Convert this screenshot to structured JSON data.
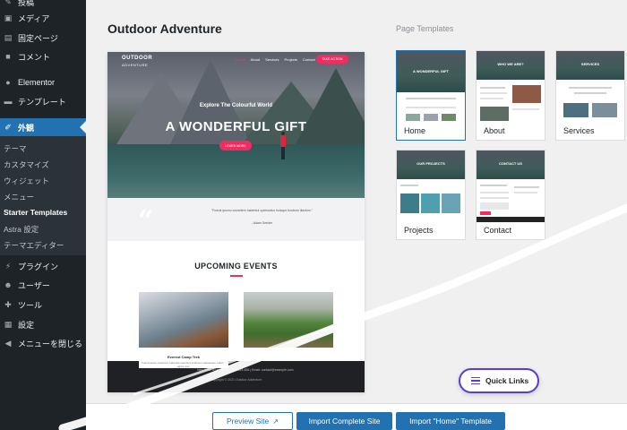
{
  "sidebar": {
    "items": [
      {
        "label": "投稿",
        "icon": "pushpin-icon"
      },
      {
        "label": "メディア",
        "icon": "media-icon"
      },
      {
        "label": "固定ページ",
        "icon": "page-icon"
      },
      {
        "label": "コメント",
        "icon": "comment-icon"
      },
      {
        "label": "Elementor",
        "icon": "elementor-icon"
      },
      {
        "label": "テンプレート",
        "icon": "folder-icon"
      },
      {
        "label": "外観",
        "icon": "brush-icon"
      }
    ],
    "submenu": [
      "テーマ",
      "カスタマイズ",
      "ウィジェット",
      "メニュー",
      "Starter Templates",
      "Astra 設定",
      "テーマエディター"
    ],
    "bottom_items": [
      {
        "label": "プラグイン",
        "icon": "plugin-icon"
      },
      {
        "label": "ユーザー",
        "icon": "user-icon"
      },
      {
        "label": "ツール",
        "icon": "wrench-icon"
      },
      {
        "label": "設定",
        "icon": "settings-icon"
      },
      {
        "label": "メニューを閉じる",
        "icon": "collapse-icon"
      }
    ]
  },
  "main": {
    "site_title": "Outdoor Adventure",
    "templates_heading": "Page Templates"
  },
  "preview": {
    "logo_line1": "OUTDOOR",
    "logo_line2": "ADVENTURE",
    "nav": [
      "Home",
      "About",
      "Services",
      "Projects",
      "Contact"
    ],
    "cta": "TAKE ACTION",
    "hero_sub": "Explore The Colourful World",
    "hero_headline": "A WONDERFUL GIFT",
    "hero_button": "LEARN MORE",
    "testimonial": "\"Fuerat ipsonu consetem habentur quiescelus huisque bostrum iliactom.\"",
    "testimonial_author": "- Adam Seeder",
    "events_title": "UPCOMING EVENTS",
    "event_caption": "Everest Camp Trek",
    "event_desc": "Fuerat aestu carentem habentia spectent tonitrua mutastatque caligine agitur quo.",
    "footer_address": "New York, USA | Phone: 888 123-456 | Email: contact@example.com",
    "footer_copy": "Copyright © 2021 Outdoor Adventure"
  },
  "templates": [
    {
      "label": "Home",
      "hero_text": "A WONDERFUL GIFT"
    },
    {
      "label": "About",
      "hero_text": "WHO WE ARE?"
    },
    {
      "label": "Services",
      "hero_text": "SERVICES"
    },
    {
      "label": "Projects",
      "hero_text": "OUR PROJECTS"
    },
    {
      "label": "Contact",
      "hero_text": "CONTACT US"
    }
  ],
  "buttons": {
    "preview_site": "Preview Site",
    "import_complete": "Import Complete Site",
    "import_home": "Import \"Home\" Template"
  },
  "quick_links": "Quick Links",
  "colors": {
    "sidebar_bg": "#1d2327",
    "wp_blue": "#2271b1",
    "accent_pink": "#f22c62",
    "quick_links_border": "#5b3bd2"
  }
}
